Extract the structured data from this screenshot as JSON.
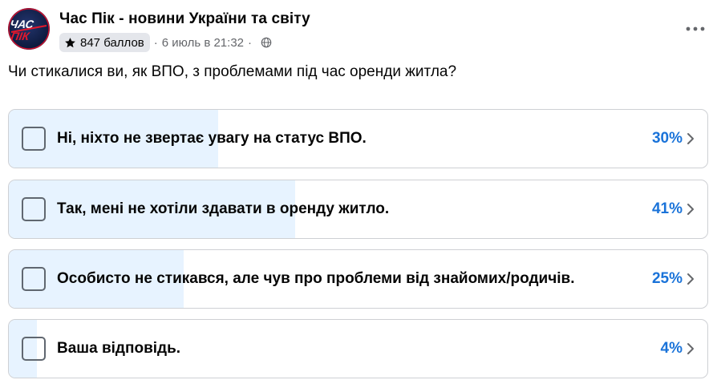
{
  "post": {
    "page_name": "Час Пік - новини України та світу",
    "avatar_text": "Час Пік",
    "points": "847 баллов",
    "separator": "·",
    "date": "6 июль в 21:32",
    "more_icon": "more-horizontal-icon"
  },
  "poll": {
    "question": "Чи стикалися ви, як ВПО, з проблемами під час оренди житла?",
    "accent_color": "#1a73d9",
    "fill_color": "#e7f3ff",
    "options": [
      {
        "label": "Ні, ніхто не звертає увагу на статус ВПО.",
        "percent_text": "30%",
        "percent": 30
      },
      {
        "label": "Так, мені не хотіли здавати в оренду житло.",
        "percent_text": "41%",
        "percent": 41
      },
      {
        "label": "Особисто не стикався, але чув про проблеми від знайомих/родичів.",
        "percent_text": "25%",
        "percent": 25
      },
      {
        "label": "Ваша відповідь.",
        "percent_text": "4%",
        "percent": 4
      }
    ]
  }
}
